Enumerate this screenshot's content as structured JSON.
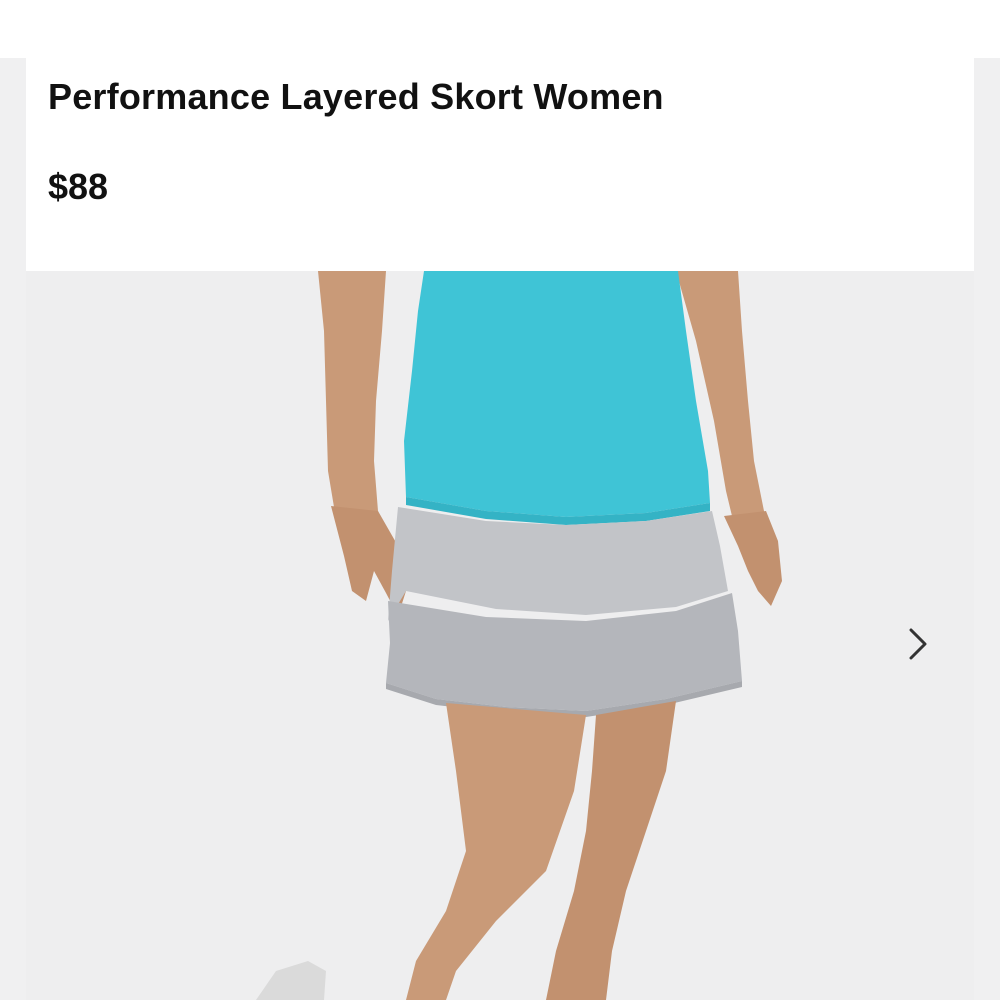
{
  "product": {
    "title": "Performance Layered Skort Women",
    "price": "$88"
  },
  "gallery": {
    "image_label": "product-photo-model-wearing-gray-layered-skort",
    "next_icon": "chevron-right-icon"
  },
  "colors": {
    "background": "#efefef",
    "card": "#ffffff",
    "text": "#111111",
    "top_shirt": "#3fc4d6",
    "skort": "#b8babe",
    "skin": "#c99a78"
  }
}
